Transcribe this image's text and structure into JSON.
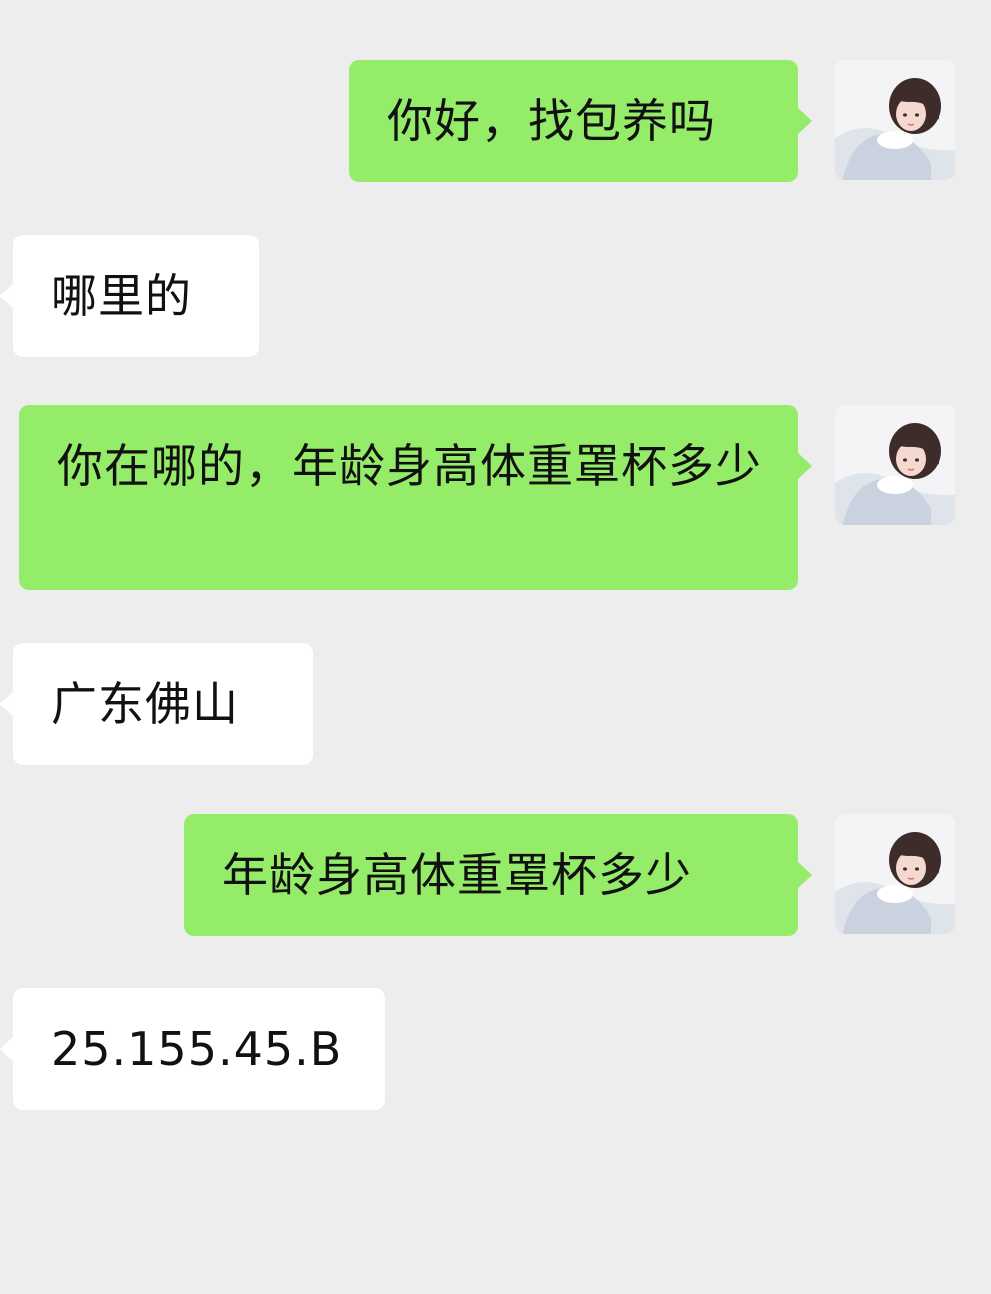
{
  "colors": {
    "background": "#ededed",
    "outgoing_bubble": "#95ec69",
    "incoming_bubble": "#ffffff",
    "text": "#111111"
  },
  "conversation": {
    "messages": [
      {
        "direction": "outgoing",
        "text": "你好，找包养吗",
        "avatar": "girl-avatar-icon"
      },
      {
        "direction": "incoming",
        "text": "哪里的"
      },
      {
        "direction": "outgoing",
        "text": "你在哪的，年龄身高体重罩杯多少",
        "avatar": "girl-avatar-icon"
      },
      {
        "direction": "incoming",
        "text": "广东佛山"
      },
      {
        "direction": "outgoing",
        "text": "年龄身高体重罩杯多少",
        "avatar": "girl-avatar-icon"
      },
      {
        "direction": "incoming",
        "text": "25.155.45.B"
      }
    ]
  }
}
